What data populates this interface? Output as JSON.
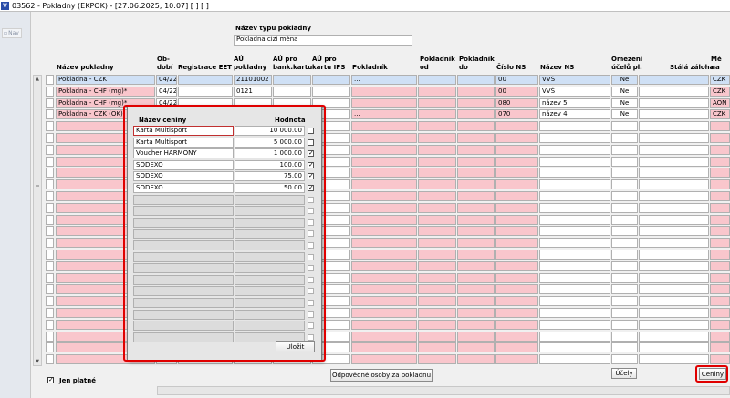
{
  "window": {
    "title": "03562 - Pokladny (EKPOK) - [27.06.2025; 10:07]  [ ]  [ ]"
  },
  "nav": {
    "label": "Nav"
  },
  "type_field": {
    "label": "Název typu pokladny",
    "value": "Pokladna cizí měna"
  },
  "headers": {
    "nazev": "Název pokladny",
    "obdobi1": "Ob-",
    "obdobi2": "dobí",
    "reg_eet": "Registrace EET",
    "au_pokl1": "AÚ",
    "au_pokl2": "pokladny",
    "au_bank1": "AÚ pro",
    "au_bank2": "bank.kartu",
    "au_ips1": "AÚ pro",
    "au_ips2": "kartu IPS",
    "pokladnik": "Pokladník",
    "pokl_od1": "Pokladník",
    "pokl_od2": "od",
    "pokl_do1": "Pokladník",
    "pokl_do2": "do",
    "cislo_ns": "Číslo NS",
    "nazev_ns": "Název NS",
    "omez1": "Omezení",
    "omez2": "účelů pl.",
    "stala": "Stálá záloha",
    "mena1": "Mě",
    "mena2": "na"
  },
  "rows": [
    {
      "nazev": "Pokladna  - CZK",
      "obdobi": "04/22",
      "eet": "",
      "au": "21101002",
      "bank": "",
      "ips": "",
      "pokladnik": "...",
      "od": "",
      "do": "",
      "cislo": "00",
      "nazev_ns": "VVŠ",
      "omez": "Ne",
      "stala": "",
      "mena": "CZK"
    },
    {
      "nazev": "Pokladna - CHF (mg)*",
      "obdobi": "04/22",
      "eet": "",
      "au": "0121",
      "bank": "",
      "ips": "",
      "pokladnik": "",
      "od": "",
      "do": "",
      "cislo": "00",
      "nazev_ns": "VVŠ",
      "omez": "Ne",
      "stala": "",
      "mena": "CZK"
    },
    {
      "nazev": "Pokladna - CHF (mg)*",
      "obdobi": "04/22",
      "eet": "",
      "au": "",
      "bank": "",
      "ips": "",
      "pokladnik": "",
      "od": "",
      "do": "",
      "cislo": "080",
      "nazev_ns": "název 5",
      "omez": "Ne",
      "stala": "",
      "mena": "AON"
    },
    {
      "nazev": "Pokladna - CZK (OK)",
      "obdobi": "",
      "eet": "",
      "au": "",
      "bank": "",
      "ips": "",
      "pokladnik": "...",
      "od": "",
      "do": "",
      "cislo": "070",
      "nazev_ns": "název 4",
      "omez": "Ne",
      "stala": "",
      "mena": "CZK"
    }
  ],
  "popup": {
    "header_name": "Název ceniny",
    "header_value": "Hodnota",
    "items": [
      {
        "name": "Karta Multisport",
        "value": "10 000.00",
        "checked": false
      },
      {
        "name": "Karta Multisport",
        "value": "5 000.00",
        "checked": false
      },
      {
        "name": "Voucher HARMONY",
        "value": "1 000.00",
        "checked": true
      },
      {
        "name": "SODEXO",
        "value": "100.00",
        "checked": true
      },
      {
        "name": "SODEXO",
        "value": "75.00",
        "checked": true
      },
      {
        "name": "SODEXO",
        "value": "50.00",
        "checked": true
      }
    ],
    "save_label": "Uložit"
  },
  "footer": {
    "jen_platne": "Jen platné",
    "jen_platne_checked": true,
    "osoby_button": "Odpovědné osoby za pokladnu",
    "ucely_button": "Účely",
    "ceniny_button": "Ceniny"
  },
  "colors": {
    "required": "#f9c6cc",
    "selected": "#cfe0f5",
    "highlight": "#e00000"
  }
}
